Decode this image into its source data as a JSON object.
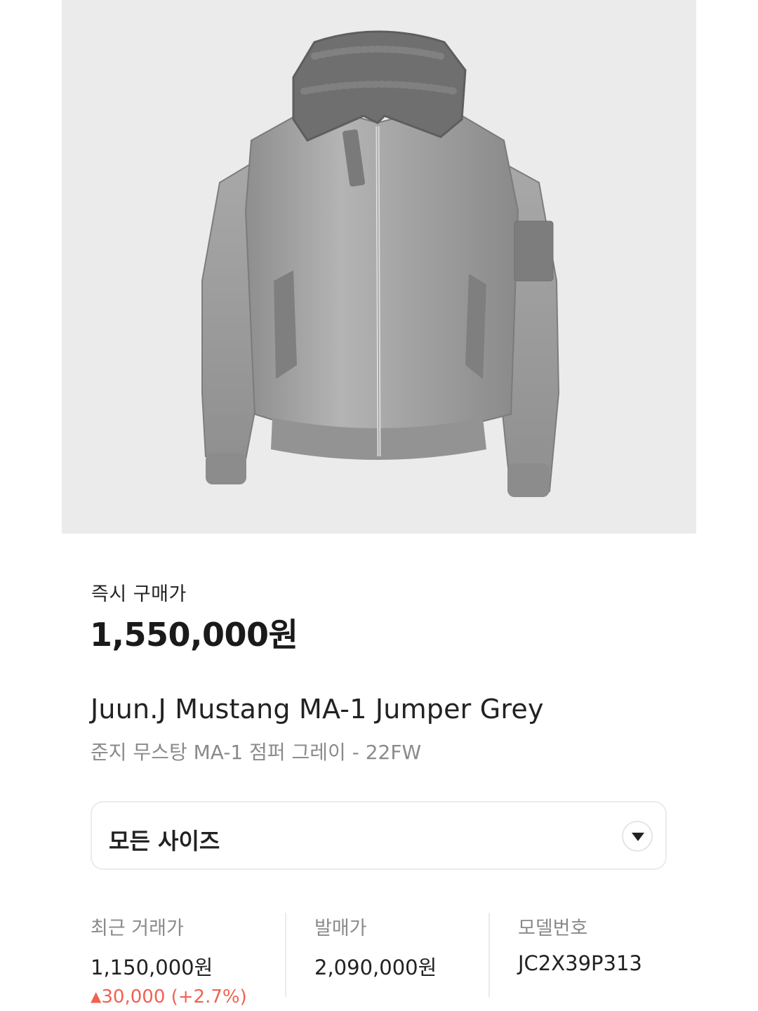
{
  "product": {
    "image_icon": "grey-bomber-jacket-image",
    "price_label": "즉시 구매가",
    "price": "1,550,000원",
    "name_en": "Juun.J Mustang MA-1 Jumper Grey",
    "name_ko": "준지 무스탕 MA-1 점퍼 그레이 - 22FW"
  },
  "size_select": {
    "label": "모든 사이즈",
    "icon": "chevron-down-icon"
  },
  "info": {
    "recent_trade": {
      "title": "최근 거래가",
      "value": "1,150,000원",
      "change_arrow": "▲",
      "change": "30,000 (+2.7%)"
    },
    "release_price": {
      "title": "발매가",
      "value": "2,090,000원"
    },
    "model_number": {
      "title": "모델번호",
      "value": "JC2X39P313"
    }
  },
  "colors": {
    "accent_up": "#ef6253",
    "muted_text": "#8a8a8a",
    "border": "#ebebeb"
  }
}
